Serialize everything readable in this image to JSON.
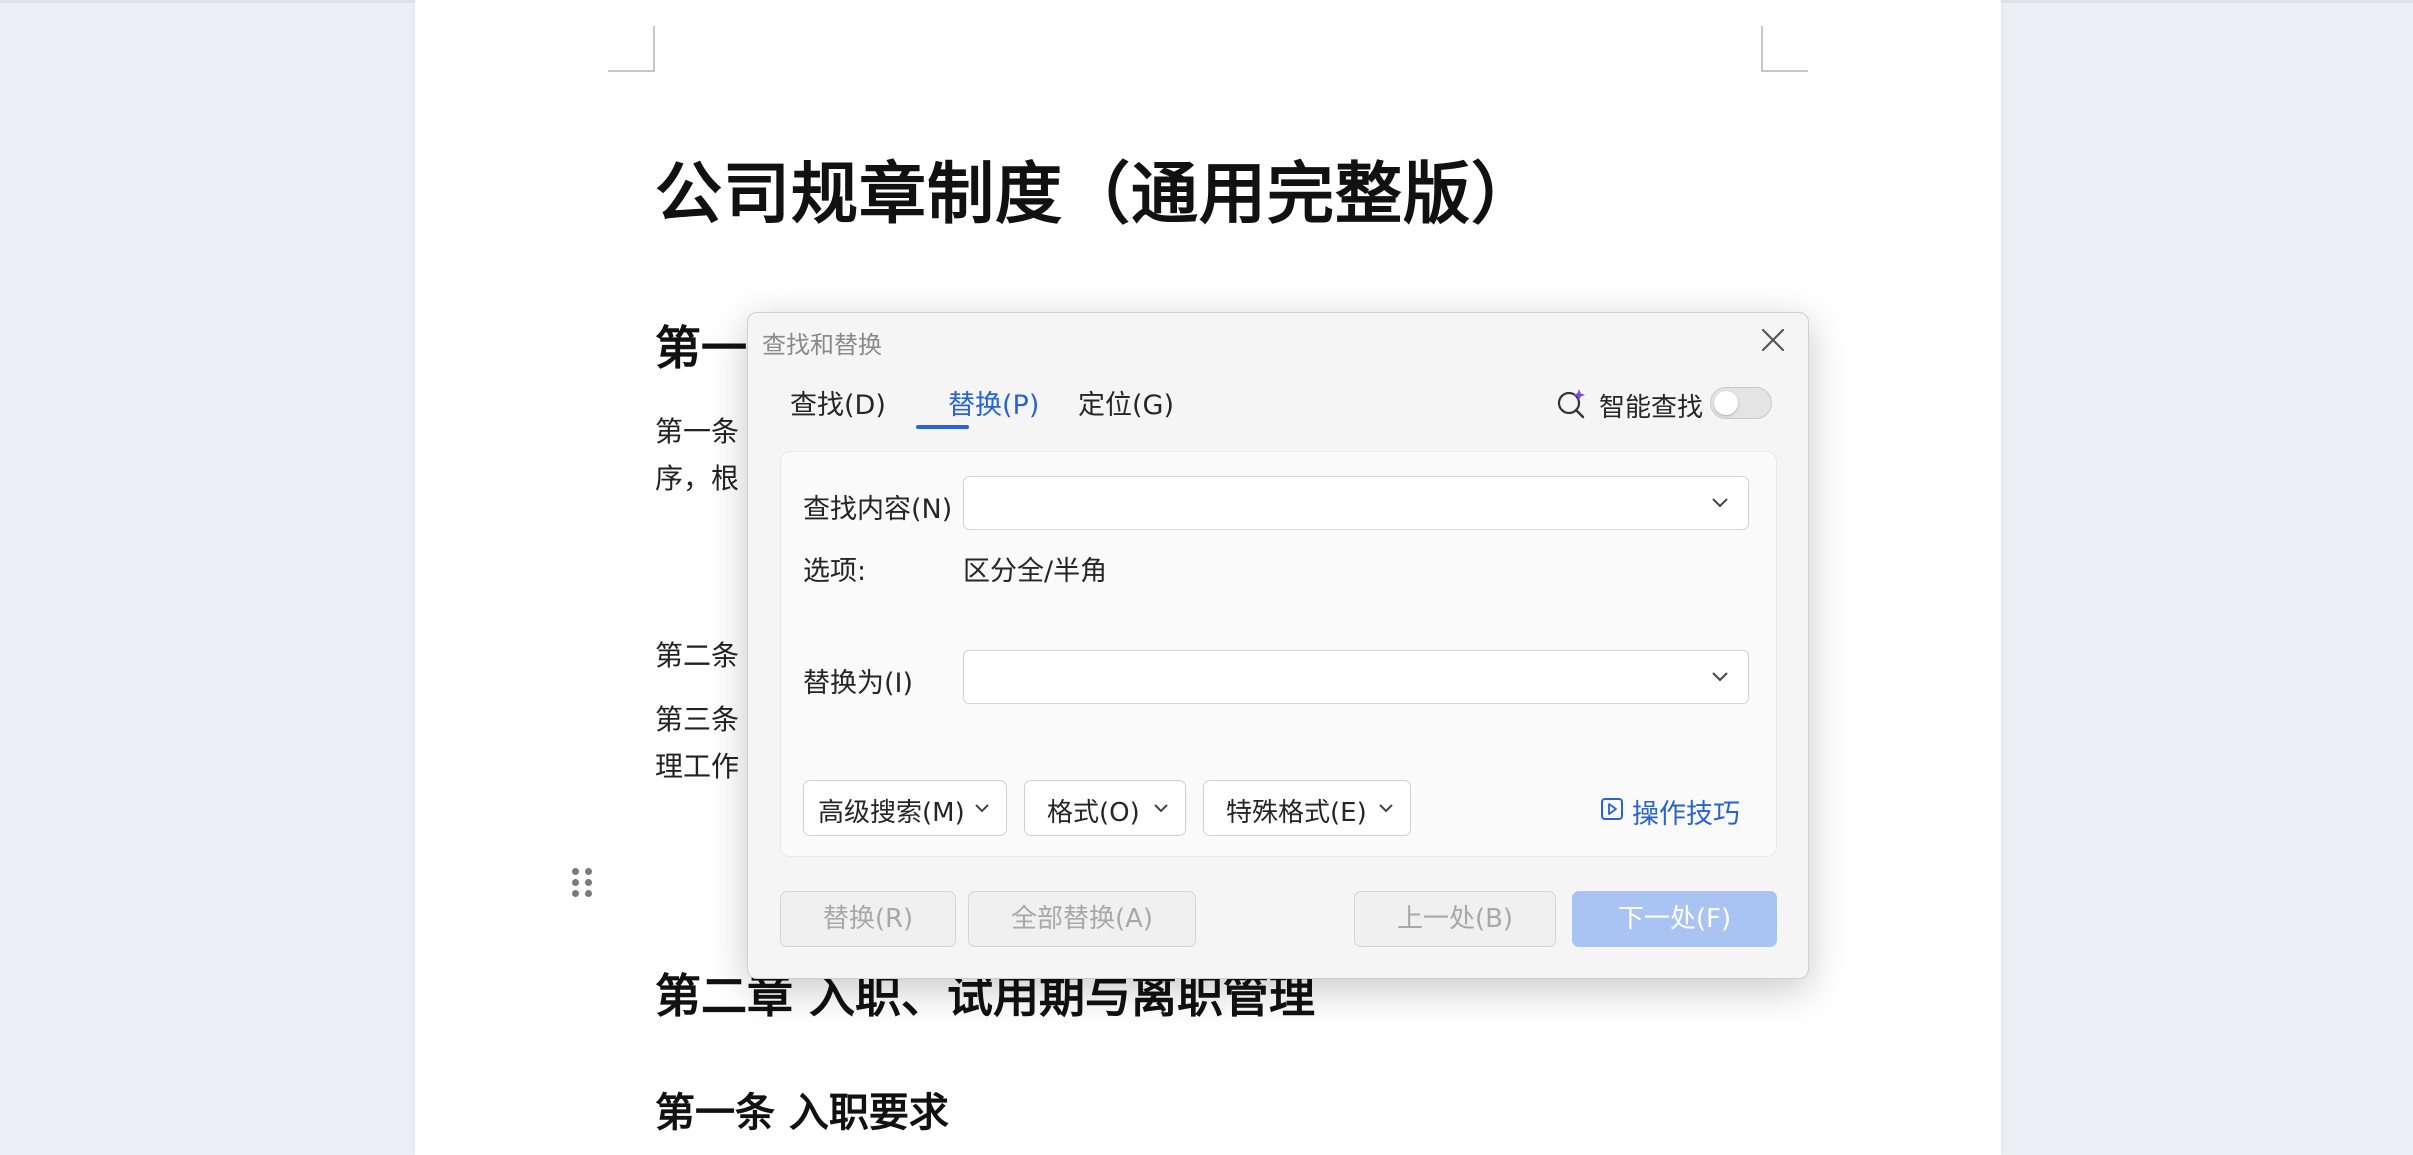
{
  "document": {
    "title": "公司规章制度（通用完整版）",
    "heading_partial": "第一",
    "para1_line1": "第一条",
    "para1_line2": "序，根",
    "para2_line1": "第二条",
    "para3_line1": "第三条",
    "para3_line2": "理工作",
    "chapter2_heading": "第二章 入职、试用期与离职管理",
    "section1_heading": "第一条 入职要求"
  },
  "dialog": {
    "title": "查找和替换",
    "tabs": [
      {
        "label": "查找(D)",
        "active": false
      },
      {
        "label": "替换(P)",
        "active": true
      },
      {
        "label": "定位(G)",
        "active": false
      }
    ],
    "smart_search": {
      "label": "智能查找",
      "enabled": false
    },
    "find_label": "查找内容(N)",
    "find_value": "",
    "options_label": "选项:",
    "options_value": "区分全/半角",
    "replace_label": "替换为(I)",
    "replace_value": "",
    "advanced_search": "高级搜索(M)",
    "format": "格式(O)",
    "special_format": "特殊格式(E)",
    "tips": "操作技巧",
    "buttons": {
      "replace": "替换(R)",
      "replace_all": "全部替换(A)",
      "previous": "上一处(B)",
      "next": "下一处(F)"
    }
  },
  "colors": {
    "accent": "#2a63d6",
    "primary_disabled": "#a9c3f2"
  }
}
